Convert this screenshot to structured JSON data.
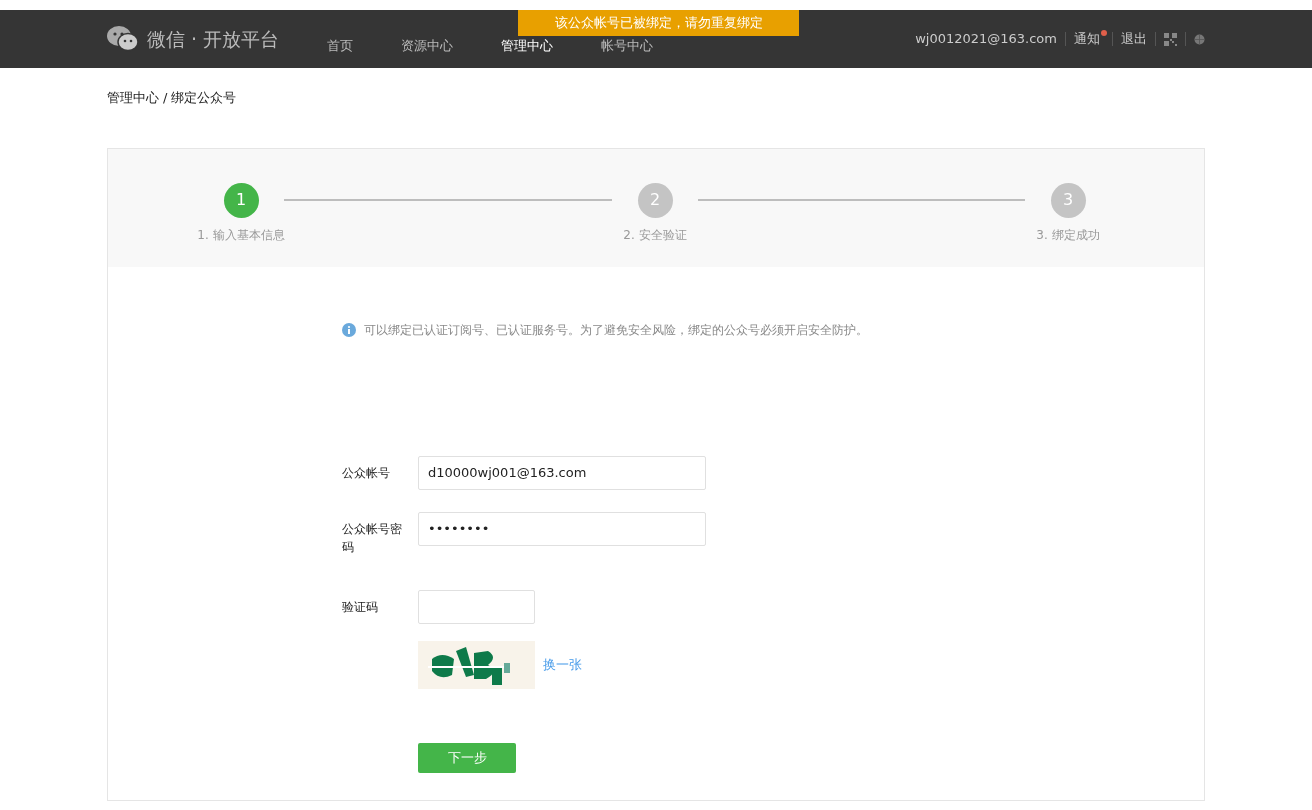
{
  "toast": {
    "text": "该公众帐号已被绑定，请勿重复绑定"
  },
  "header": {
    "brand": "微信 · 开放平台",
    "nav": [
      {
        "label": "首页",
        "selected": false
      },
      {
        "label": "资源中心",
        "selected": false
      },
      {
        "label": "管理中心",
        "selected": true
      },
      {
        "label": "帐号中心",
        "selected": false
      }
    ],
    "user": "wj0012021@163.com",
    "notice": {
      "label": "通知",
      "unread": true
    },
    "logout": "退出"
  },
  "breadcrumb": {
    "separator": "/",
    "items": [
      {
        "label": "管理中心"
      },
      {
        "label": "绑定公众号"
      }
    ]
  },
  "steps": [
    {
      "number": "1",
      "label": "1. 输入基本信息",
      "selected": true
    },
    {
      "number": "2",
      "label": "2. 安全验证",
      "selected": false
    },
    {
      "number": "3",
      "label": "3. 绑定成功",
      "selected": false
    }
  ],
  "info": "可以绑定已认证订阅号、已认证服务号。为了避免安全风险，绑定的公众号必须开启安全防护。",
  "form": [
    {
      "label": "公众帐号",
      "kind": "text",
      "value": "d10000wj001@163.com"
    },
    {
      "label": "公众帐号密码",
      "kind": "password",
      "value": "••••••••"
    },
    {
      "label": "验证码",
      "kind": "captcha"
    }
  ],
  "captcha": {
    "refresh": "换一张"
  },
  "submit": "下一步"
}
